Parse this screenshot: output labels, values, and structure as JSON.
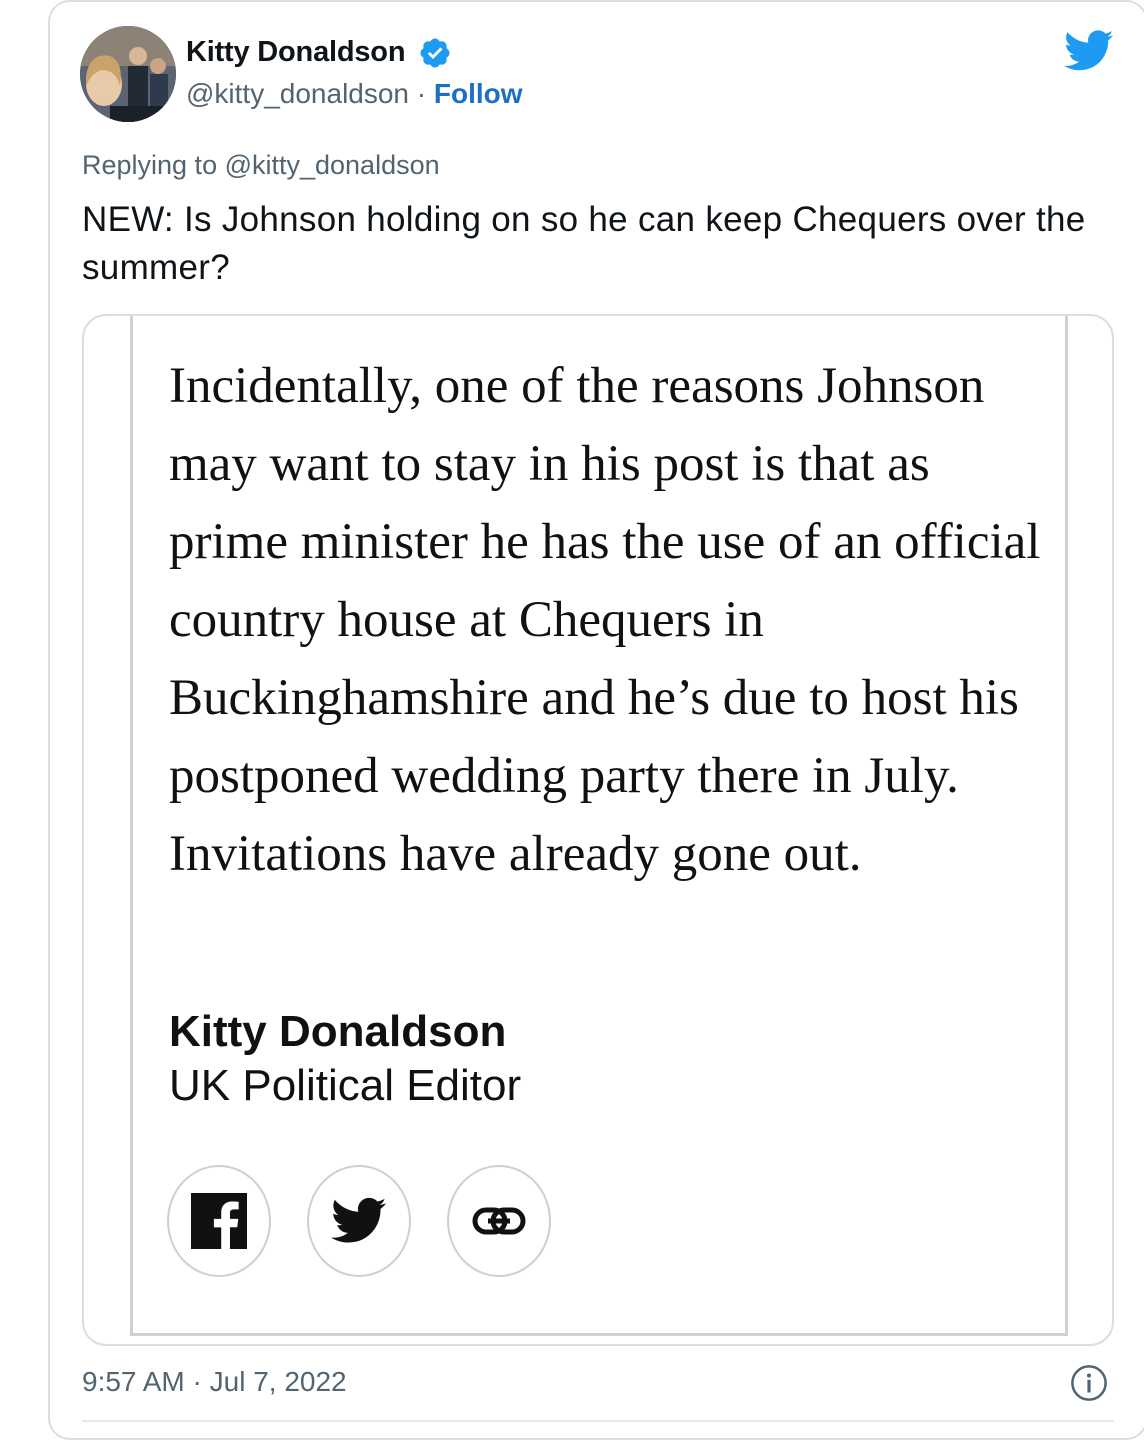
{
  "author": {
    "name": "Kitty Donaldson",
    "handle": "@kitty_donaldson",
    "separator": "·",
    "follow_label": "Follow"
  },
  "tweet": {
    "replying_to": "Replying to @kitty_donaldson",
    "text": "NEW: Is Johnson holding on so he can keep Chequers over the summer?"
  },
  "media": {
    "quote": "Incidentally, one of the reasons Johnson may want to stay in his post is that as prime minister he has the use of an official country house at Chequers in Buckinghamshire and he’s due to host his postponed wedding party there in July. Invitations have already gone out.",
    "signature_name": "Kitty Donaldson",
    "signature_title": "UK Political Editor",
    "share_icons": [
      "facebook-icon",
      "twitter-icon",
      "link-icon"
    ]
  },
  "footer": {
    "time": "9:57 AM",
    "separator": "·",
    "date": "Jul 7, 2022"
  },
  "colors": {
    "twitter_blue": "#1d9bf0",
    "follow_blue": "#1d6fc4",
    "secondary_text": "#536471",
    "border": "#d9dee2"
  }
}
